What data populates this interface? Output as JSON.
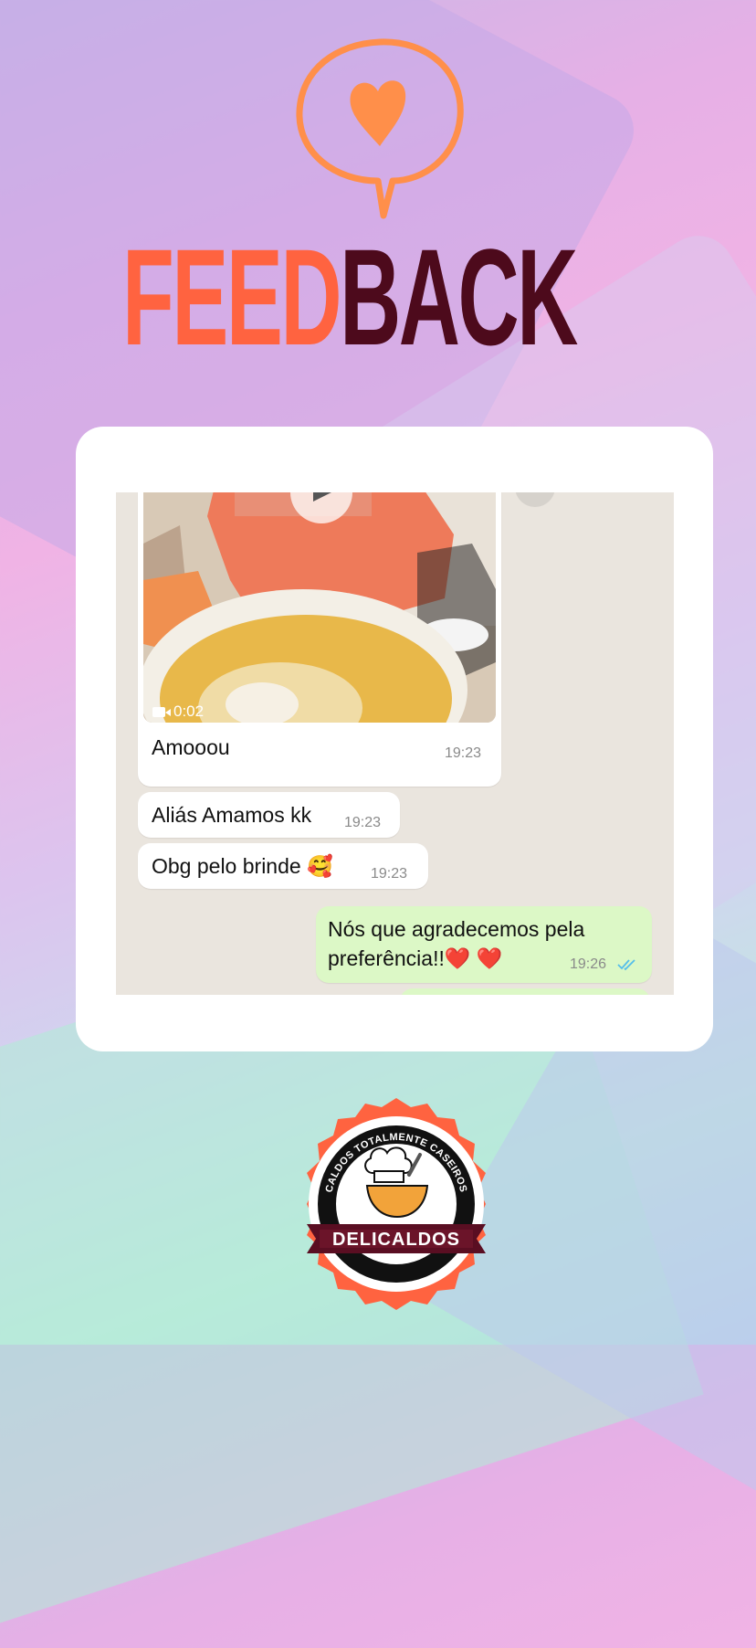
{
  "title": {
    "part1": "FEED",
    "part2": "BACK"
  },
  "colors": {
    "accent_orange": "#ff6340",
    "accent_dark": "#4d0a1c",
    "bubble_orange": "#ff8f4a",
    "chat_bg": "#eae5de",
    "outgoing_bubble": "#dcf8c6",
    "read_ticks": "#53bdeb"
  },
  "chat": {
    "video": {
      "duration": "0:02",
      "play_icon": "play-icon",
      "camera_icon": "video-camera-icon"
    },
    "messages": [
      {
        "text": "Amooou",
        "time": "19:23",
        "direction": "incoming"
      },
      {
        "text": "Aliás Amamos kk",
        "time": "19:23",
        "direction": "incoming"
      },
      {
        "text": "Obg pelo brinde 🥰",
        "time": "19:23",
        "direction": "incoming"
      },
      {
        "text_line1": "Nós que agradecemos pela",
        "text_line2": "preferência!!❤️ ❤️",
        "time": "19:26",
        "direction": "outgoing",
        "status_icon": "double-check-icon"
      }
    ]
  },
  "logo": {
    "arc_text": "CALDOS TOTALMENTE CASEIROS",
    "brand": "DELICALDOS"
  }
}
